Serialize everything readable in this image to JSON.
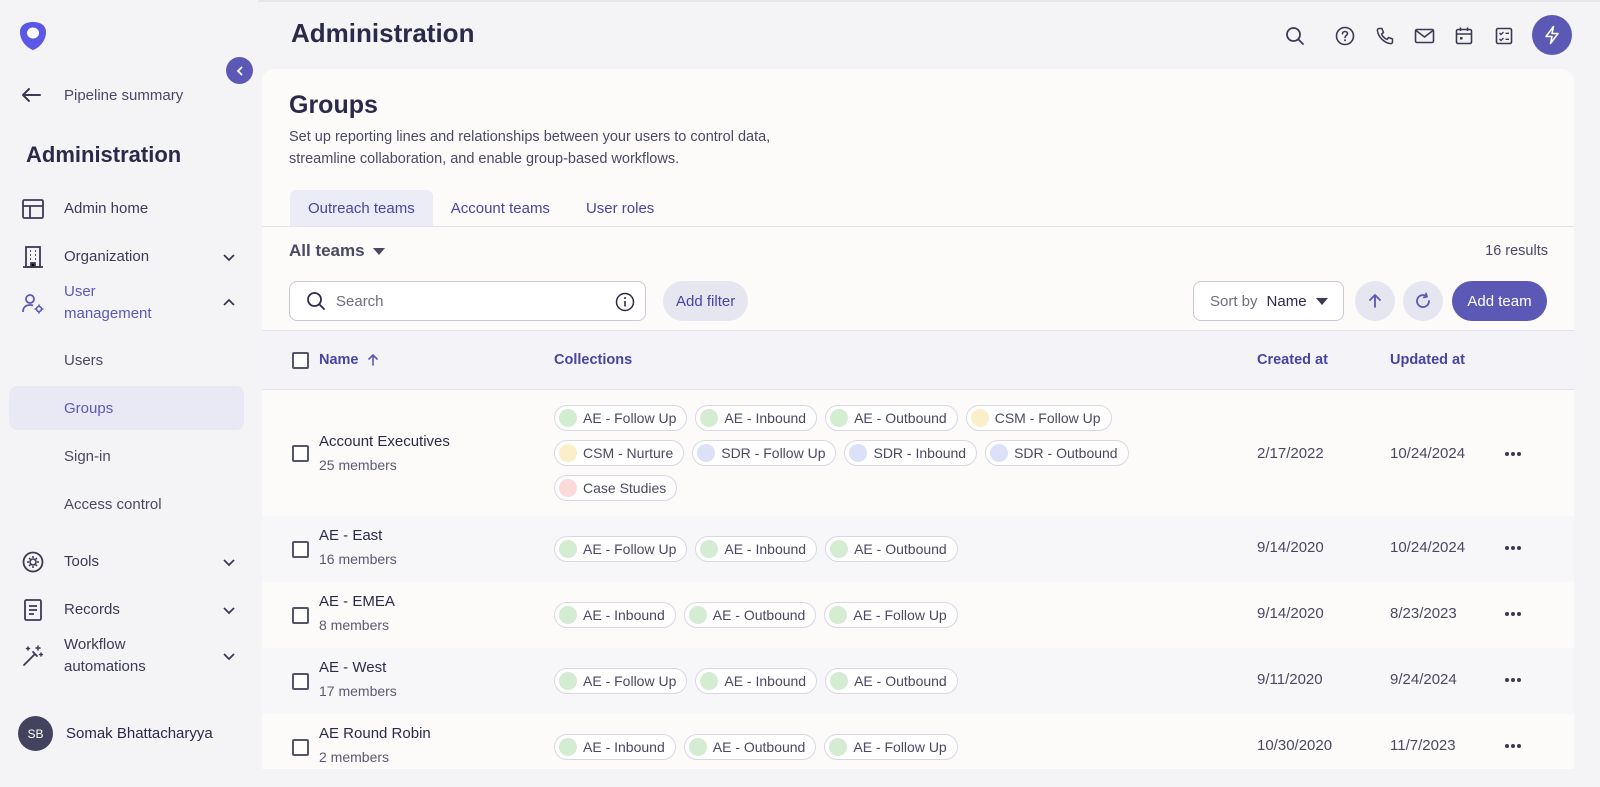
{
  "colors": {
    "accent": "#5b58b6",
    "green_dot": "#d4ecd2",
    "yellow_dot": "#fbefc9",
    "blue_dot": "#dbe2f7",
    "pink_dot": "#fbdbd9"
  },
  "header": {
    "title": "Administration"
  },
  "sidebar": {
    "back_label": "Pipeline summary",
    "title": "Administration",
    "nav": {
      "admin_home": "Admin home",
      "organization": "Organization",
      "user_management": "User management",
      "tools": "Tools",
      "records": "Records",
      "workflow_automations": "Workflow automations"
    },
    "sub": {
      "users": "Users",
      "groups": "Groups",
      "sign_in": "Sign-in",
      "access_control": "Access control"
    },
    "user": {
      "initials": "SB",
      "name": "Somak Bhattacharyya"
    }
  },
  "main": {
    "title": "Groups",
    "description": "Set up reporting lines and relationships between your users to control data, streamline collaboration, and enable group-based workflows.",
    "tabs": [
      "Outreach teams",
      "Account teams",
      "User roles"
    ],
    "filter_label": "All teams",
    "results": "16 results",
    "search_placeholder": "Search",
    "add_filter": "Add filter",
    "sort_label": "Sort by",
    "sort_value": "Name",
    "add_team": "Add team"
  },
  "table": {
    "columns": [
      "Name",
      "Collections",
      "Created at",
      "Updated at"
    ],
    "rows": [
      {
        "name": "Account Executives",
        "members": "25 members",
        "created": "2/17/2022",
        "updated": "10/24/2024",
        "collections": [
          {
            "label": "AE - Follow Up",
            "color": "green"
          },
          {
            "label": "AE - Inbound",
            "color": "green"
          },
          {
            "label": "AE - Outbound",
            "color": "green"
          },
          {
            "label": "CSM - Follow Up",
            "color": "yellow"
          },
          {
            "label": "CSM - Nurture",
            "color": "yellow"
          },
          {
            "label": "SDR - Follow Up",
            "color": "blue"
          },
          {
            "label": "SDR - Inbound",
            "color": "blue"
          },
          {
            "label": "SDR - Outbound",
            "color": "blue"
          },
          {
            "label": "Case Studies",
            "color": "pink"
          }
        ]
      },
      {
        "name": "AE - East",
        "members": "16 members",
        "created": "9/14/2020",
        "updated": "10/24/2024",
        "collections": [
          {
            "label": "AE - Follow Up",
            "color": "green"
          },
          {
            "label": "AE - Inbound",
            "color": "green"
          },
          {
            "label": "AE - Outbound",
            "color": "green"
          }
        ]
      },
      {
        "name": "AE - EMEA",
        "members": "8 members",
        "created": "9/14/2020",
        "updated": "8/23/2023",
        "collections": [
          {
            "label": "AE - Inbound",
            "color": "green"
          },
          {
            "label": "AE - Outbound",
            "color": "green"
          },
          {
            "label": "AE - Follow Up",
            "color": "green"
          }
        ]
      },
      {
        "name": "AE - West",
        "members": "17 members",
        "created": "9/11/2020",
        "updated": "9/24/2024",
        "collections": [
          {
            "label": "AE - Follow Up",
            "color": "green"
          },
          {
            "label": "AE - Inbound",
            "color": "green"
          },
          {
            "label": "AE - Outbound",
            "color": "green"
          }
        ]
      },
      {
        "name": "AE Round Robin",
        "members": "2 members",
        "created": "10/30/2020",
        "updated": "11/7/2023",
        "collections": [
          {
            "label": "AE - Inbound",
            "color": "green"
          },
          {
            "label": "AE - Outbound",
            "color": "green"
          },
          {
            "label": "AE - Follow Up",
            "color": "green"
          }
        ]
      }
    ]
  }
}
